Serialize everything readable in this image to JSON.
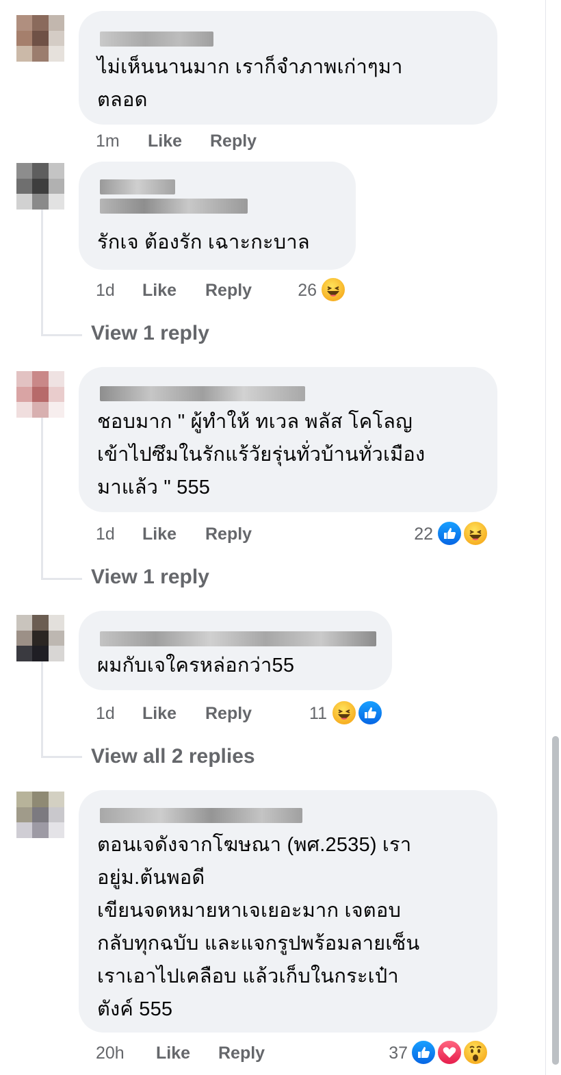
{
  "ui": {
    "like_label": "Like",
    "reply_label": "Reply"
  },
  "comments": [
    {
      "text": "ไม่เห็นนานมาก เราก็จำภาพเก่าๆมา\nตลอด",
      "time": "1m"
    },
    {
      "text": "รักเจ ต้องรัก เฉาะกะบาล",
      "time": "1d",
      "reaction_count": "26",
      "reactions": [
        "haha"
      ],
      "view_replies": "View 1 reply"
    },
    {
      "text": "ชอบมาก \" ผู้ทำให้ ทเวล พลัส โคโลญ\nเข้าไปซึมในรักแร้วัยรุ่นทั่วบ้านทั่วเมือง\nมาแล้ว \" 555",
      "time": "1d",
      "reaction_count": "22",
      "reactions": [
        "like",
        "haha"
      ],
      "view_replies": "View 1 reply"
    },
    {
      "text": "ผมกับเจใครหล่อกว่า55",
      "time": "1d",
      "reaction_count": "11",
      "reactions": [
        "haha",
        "like"
      ],
      "view_replies": "View all 2 replies"
    },
    {
      "text": "ตอนเจดังจากโฆษณา (พศ.2535) เรา\nอยู่ม.ต้นพอดี\nเขียนจดหมายหาเจเยอะมาก เจตอบ\nกลับทุกฉบับ และแจกรูปพร้อมลายเซ็น\nเราเอาไปเคลือบ แล้วเก็บในกระเป๋า\nตังค์ 555",
      "time": "20h",
      "reaction_count": "37",
      "reactions": [
        "like",
        "love",
        "wow"
      ]
    }
  ],
  "colors": {
    "bubble": "#f0f2f5",
    "meta_text": "#65676b",
    "like": "#1877f2",
    "haha": "#f7b125",
    "love": "#f33e58"
  },
  "icons": {
    "haha": "haha-reaction-icon",
    "like": "like-reaction-icon",
    "love": "love-reaction-icon",
    "wow": "wow-reaction-icon"
  }
}
